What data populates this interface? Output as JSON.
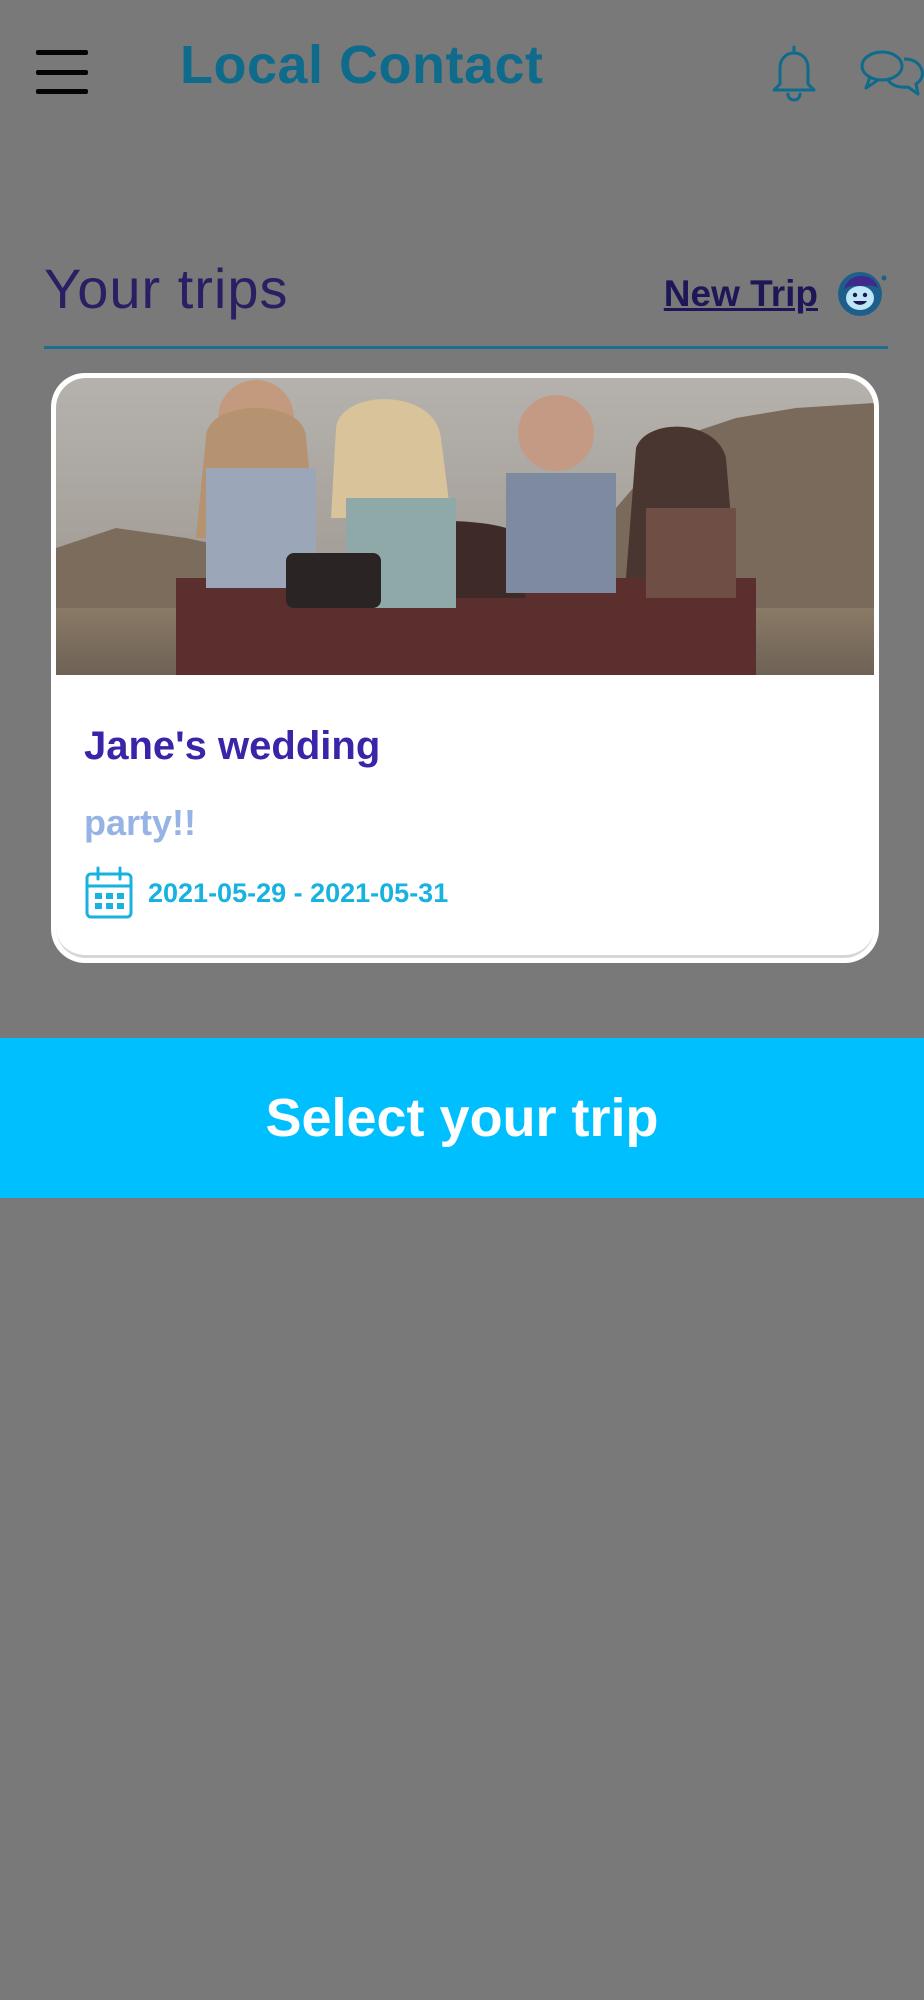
{
  "header": {
    "title": "Local Contact",
    "icons": {
      "menu": "hamburger-menu-icon",
      "notifications": "bell-icon",
      "messages": "chat-bubbles-icon"
    }
  },
  "trips_section": {
    "title": "Your trips",
    "new_trip_label": "New Trip",
    "new_trip_icon": "smiling-face-icon"
  },
  "trips": [
    {
      "name": "Jane's wedding",
      "description": "party!!",
      "dates": "2021-05-29 - 2021-05-31",
      "image": "photo of friends taking a selfie in an open car"
    }
  ],
  "actions": {
    "select_label": "Select your trip"
  },
  "colors": {
    "background_overlay": "#797979",
    "brand_title": "#0e6b8c",
    "section_title": "#2a1f63",
    "trip_name": "#3a24a8",
    "trip_description": "#96b3e6",
    "trip_dates": "#17b2e0",
    "select_button": "#00bfff"
  }
}
